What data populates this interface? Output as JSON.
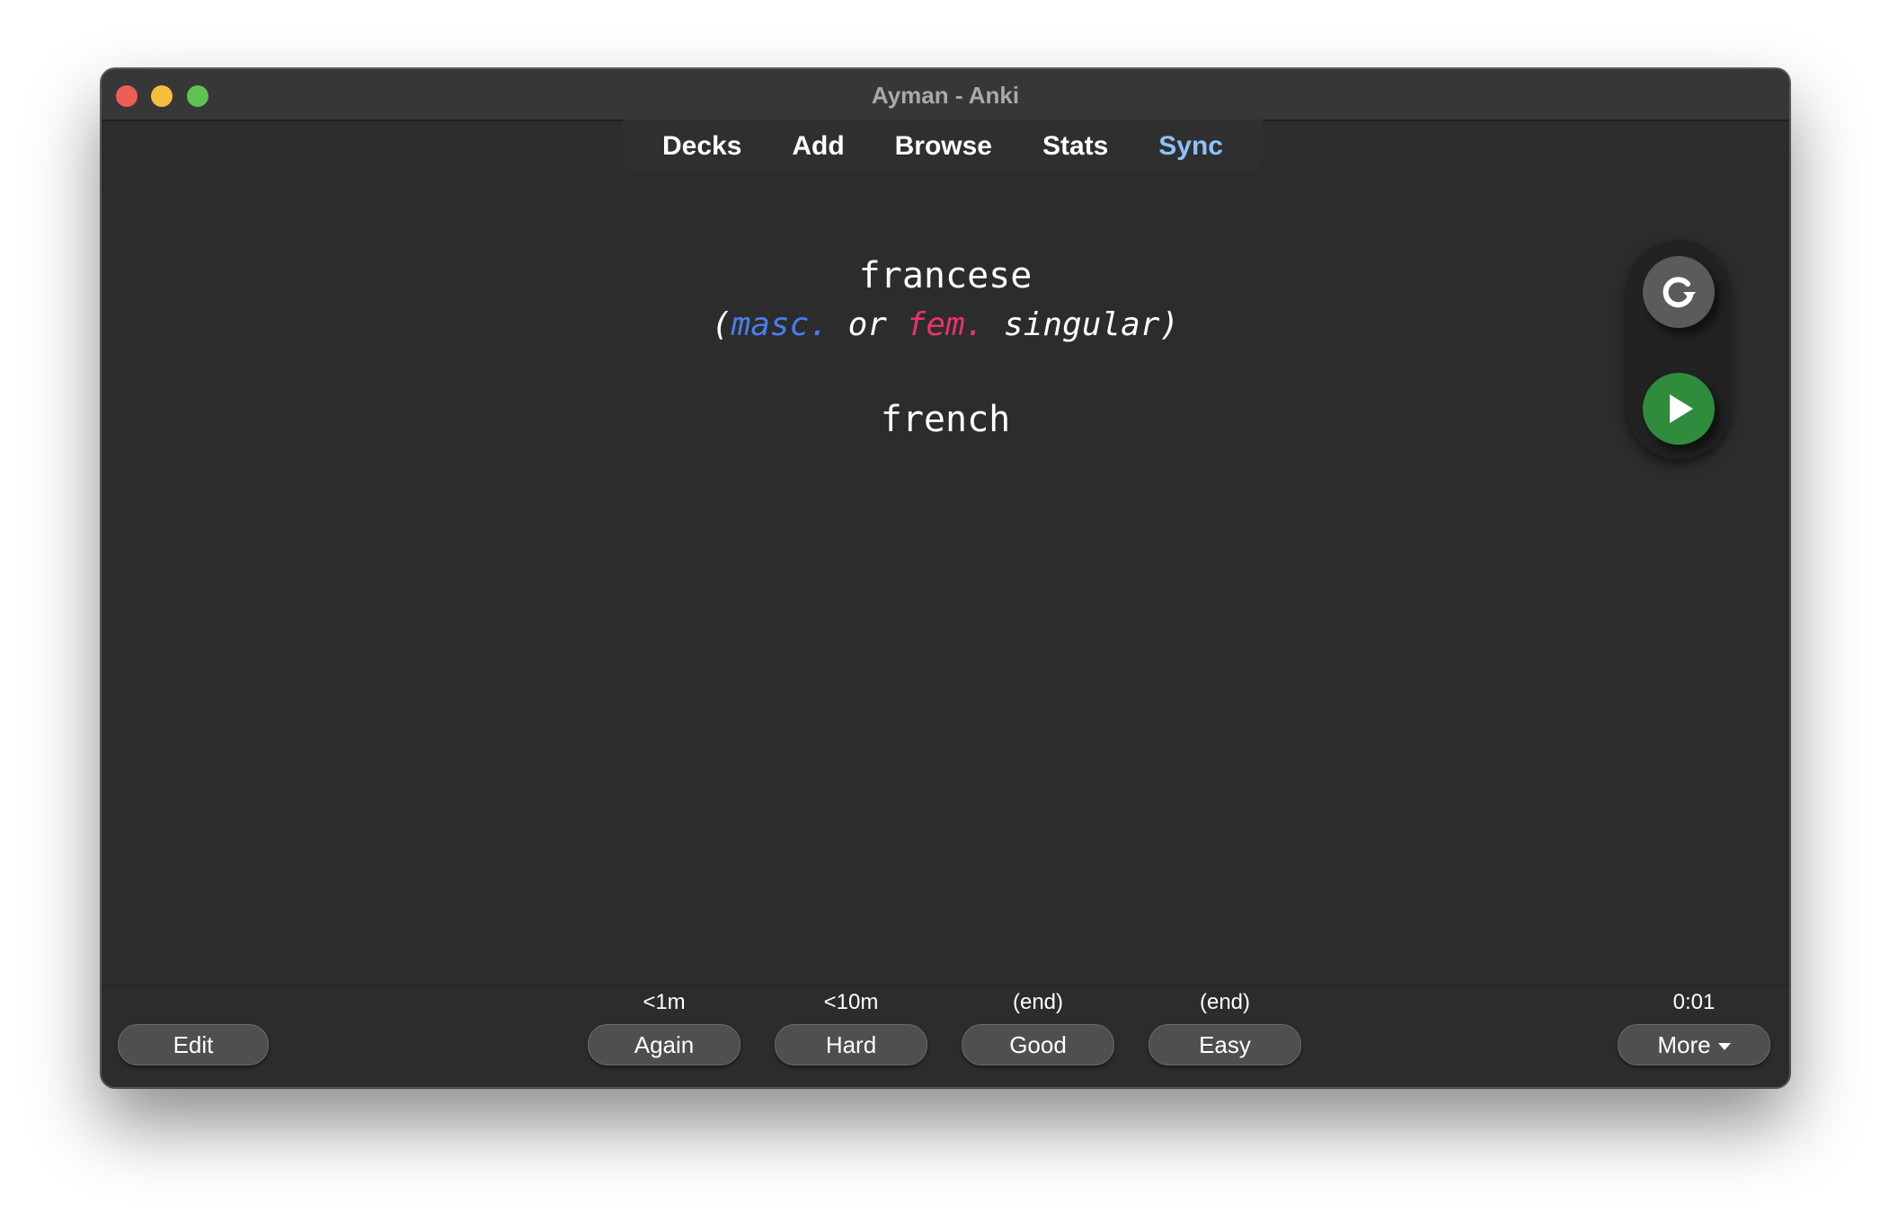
{
  "window": {
    "title": "Ayman - Anki"
  },
  "toolbar": {
    "decks": "Decks",
    "add": "Add",
    "browse": "Browse",
    "stats": "Stats",
    "sync": "Sync"
  },
  "card": {
    "front": "francese",
    "hint_open": "(",
    "hint_masc": "masc.",
    "hint_or": " or ",
    "hint_fem": "fem.",
    "hint_rest": " singular)",
    "back": "french"
  },
  "side_panel": {
    "replay_icon": "replay-icon",
    "play_icon": "play-icon"
  },
  "bottom": {
    "edit": "Edit",
    "answers": [
      {
        "interval": "<1m",
        "label": "Again"
      },
      {
        "interval": "<10m",
        "label": "Hard"
      },
      {
        "interval": "(end)",
        "label": "Good"
      },
      {
        "interval": "(end)",
        "label": "Easy"
      }
    ],
    "timer": "0:01",
    "more": "More"
  },
  "colors": {
    "masc": "#4a7cf0",
    "fem": "#e8336a",
    "sync": "#8fc1ff",
    "play": "#2f8c3c"
  }
}
